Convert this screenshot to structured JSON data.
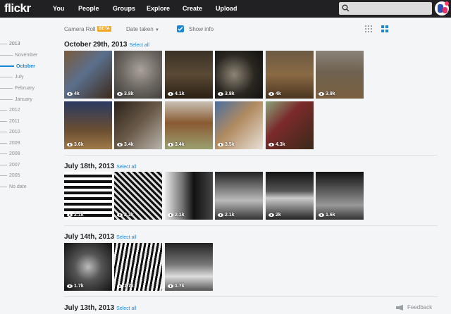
{
  "header": {
    "logo": "flickr",
    "nav": [
      {
        "label": "You"
      },
      {
        "label": "People"
      },
      {
        "label": "Groups"
      },
      {
        "label": "Explore"
      },
      {
        "label": "Create"
      },
      {
        "label": "Upload"
      }
    ],
    "search": {
      "placeholder": ""
    }
  },
  "sidebar": {
    "timeline": [
      {
        "label": "2013",
        "kind": "year",
        "name": "year-2013"
      },
      {
        "label": "November",
        "kind": "month",
        "name": "month-november"
      },
      {
        "label": "October",
        "kind": "month active",
        "name": "month-october"
      },
      {
        "label": "July",
        "kind": "month",
        "name": "month-july"
      },
      {
        "label": "February",
        "kind": "month",
        "name": "month-february"
      },
      {
        "label": "January",
        "kind": "month",
        "name": "month-january"
      },
      {
        "label": "2012",
        "kind": "year",
        "name": "year-2012"
      },
      {
        "label": "2011",
        "kind": "year",
        "name": "year-2011"
      },
      {
        "label": "2010",
        "kind": "year",
        "name": "year-2010"
      },
      {
        "label": "2009",
        "kind": "year",
        "name": "year-2009"
      },
      {
        "label": "2008",
        "kind": "year",
        "name": "year-2008"
      },
      {
        "label": "2007",
        "kind": "year",
        "name": "year-2007"
      },
      {
        "label": "2005",
        "kind": "year",
        "name": "year-2005"
      },
      {
        "label": "No date",
        "kind": "year",
        "name": "no-date"
      }
    ]
  },
  "toolbar": {
    "camera_roll": "Camera Roll",
    "beta": "BETA",
    "sort": "Date taken",
    "show_info": "Show info"
  },
  "sections": [
    {
      "title": "October 29th, 2013",
      "select_all": "Select all",
      "photos": [
        {
          "views": "4k",
          "bg": "linear-gradient(135deg,#7a5a3c 0%,#5b6f8c 45%,#3d2a1c 100%)"
        },
        {
          "views": "3.8k",
          "bg": "radial-gradient(circle at 55% 40%,#a9a39a 0%,#6b6660 50%,#3a3835 100%)"
        },
        {
          "views": "4.1k",
          "bg": "linear-gradient(180deg,#3b3226 0%,#5a4a35 50%,#2b1f14 100%)"
        },
        {
          "views": "3.8k",
          "bg": "radial-gradient(circle at 40% 50%,#8d8576 0%,#2a2620 55%,#111 100%)"
        },
        {
          "views": "4k",
          "bg": "linear-gradient(180deg,#6c5a44 0%,#8a6a45 50%,#4a3520 100%)"
        },
        {
          "views": "3.9k",
          "bg": "linear-gradient(180deg,#8a8278 0%,#6f6250 45%,#7b6040 100%)"
        },
        {
          "views": "3.6k",
          "bg": "linear-gradient(180deg,#2b3a62 0%,#6a4e32 60%,#a07a48 100%)"
        },
        {
          "views": "3.4k",
          "bg": "linear-gradient(135deg,#2a211a 0%,#6a5a48 50%,#b9b4ac 100%)"
        },
        {
          "views": "3.4k",
          "bg": "linear-gradient(180deg,#c8c0b3 0%,#8a5a32 45%,#9aa070 100%)"
        },
        {
          "views": "3.5k",
          "bg": "linear-gradient(135deg,#4a6fa0 0%,#b08a60 45%,#e8e0d6 100%)"
        },
        {
          "views": "4.3k",
          "bg": "linear-gradient(135deg,#8aa37a 0%,#7a2a2a 40%,#3a2a1a 100%)"
        }
      ]
    },
    {
      "title": "July 18th, 2013",
      "select_all": "Select all",
      "photos": [
        {
          "views": "2.1k",
          "bg": "repeating-linear-gradient(180deg,#fff 0px,#fff 4px,#111 4px,#111 8px)"
        },
        {
          "views": "2.1k",
          "bg": "repeating-linear-gradient(45deg,#111 0px,#111 3px,#ddd 3px,#ddd 6px)"
        },
        {
          "views": "2.1k",
          "bg": "linear-gradient(90deg,#e8e8e8 0%,#777 35%,#111 60%,#444 100%)"
        },
        {
          "views": "2.1k",
          "bg": "linear-gradient(180deg,#222 0%,#888 40%,#bbb 60%,#333 100%)"
        },
        {
          "views": "2k",
          "bg": "linear-gradient(180deg,#111 0%,#555 40%,#ccc 55%,#222 100%)"
        },
        {
          "views": "1.6k",
          "bg": "linear-gradient(180deg,#111 0%,#666 45%,#999 70%,#333 100%)"
        }
      ]
    },
    {
      "title": "July 14th, 2013",
      "select_all": "Select all",
      "photos": [
        {
          "views": "1.7k",
          "bg": "radial-gradient(circle at 50% 50%,#bbb 0%,#555 40%,#111 100%)"
        },
        {
          "views": "1.7k",
          "bg": "repeating-linear-gradient(100deg,#111 0px,#111 3px,#eee 3px,#eee 6px)"
        },
        {
          "views": "1.7k",
          "bg": "linear-gradient(180deg,#222 0%,#777 45%,#ddd 70%,#555 100%)"
        }
      ]
    },
    {
      "title": "July 13th, 2013",
      "select_all": "Select all",
      "photos": []
    }
  ],
  "feedback": {
    "label": "Feedback"
  }
}
